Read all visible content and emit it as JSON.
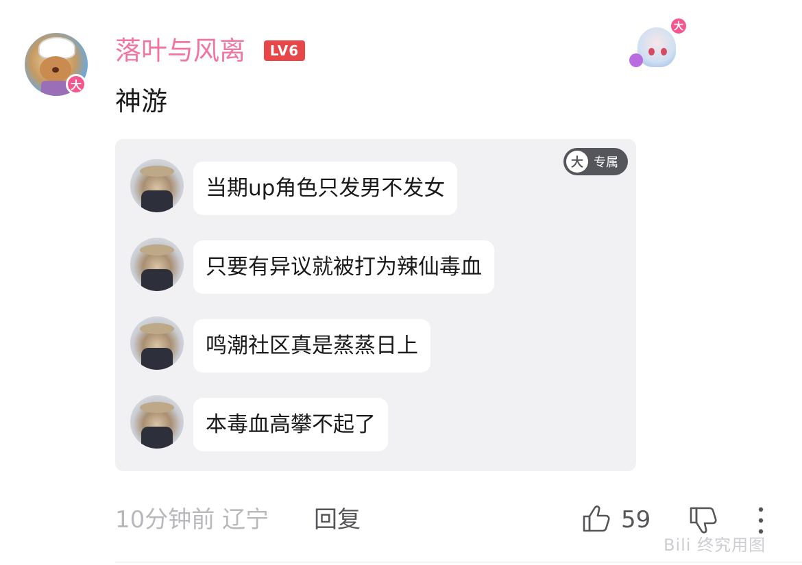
{
  "user": {
    "name": "落叶与风离",
    "level": "LV6",
    "badge": "大"
  },
  "comment": {
    "text": "神游"
  },
  "card": {
    "exclusive_icon": "大",
    "exclusive_label": "专属",
    "messages": [
      "当期up角色只发男不发女",
      "只要有异议就被打为辣仙毒血",
      "鸣潮社区真是蒸蒸日上",
      "本毒血高攀不起了"
    ]
  },
  "decoration": {
    "badge": "大"
  },
  "footer": {
    "time_location": "10分钟前 辽宁",
    "reply_label": "回复",
    "like_count": "59"
  },
  "watermark": "Bili 终究用图",
  "icons": {
    "like": "thumbs-up-icon",
    "dislike": "thumbs-down-icon",
    "more": "more-vertical-icon"
  },
  "colors": {
    "username": "#f2759e",
    "level_badge": "#e8474a",
    "da_badge": "#f5568f",
    "card_bg": "#f1f1f4",
    "meta_text": "#b8b8bd"
  }
}
